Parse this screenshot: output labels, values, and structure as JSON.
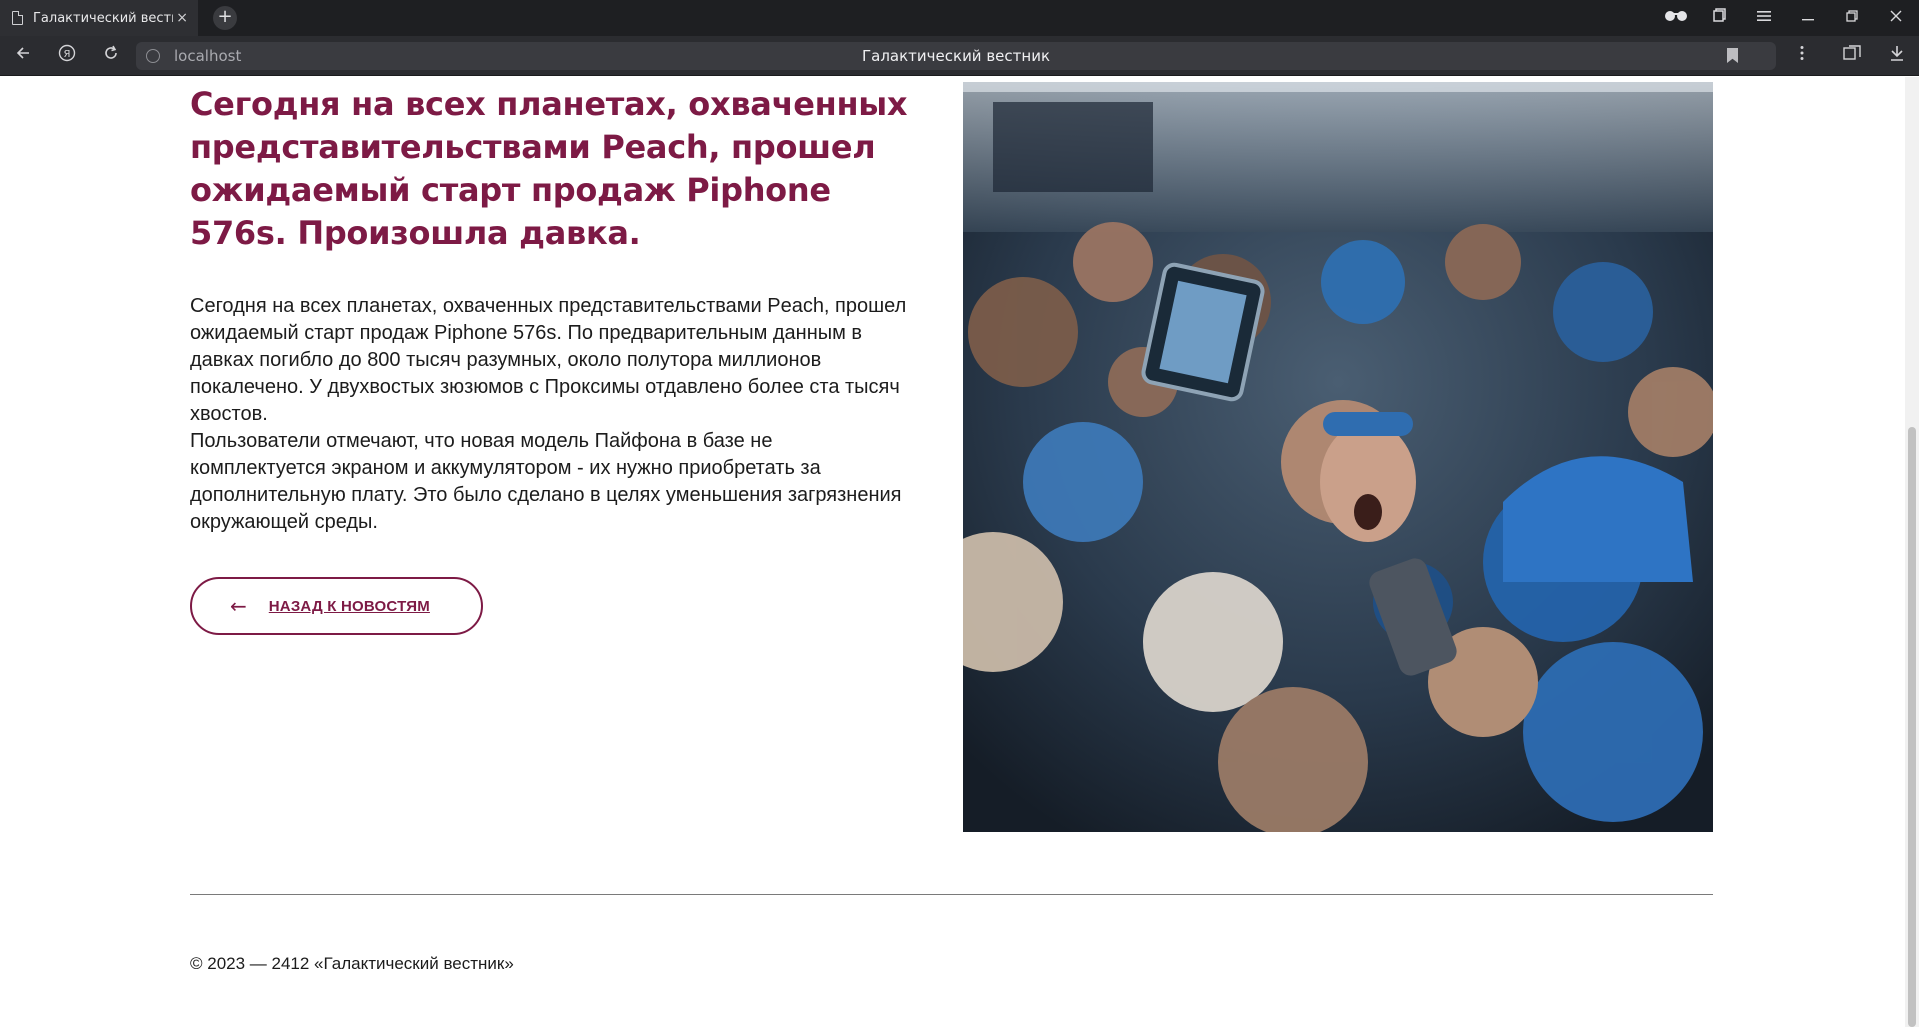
{
  "browser": {
    "tab_title": "Галактический вестник",
    "tab_close": "×",
    "new_tab": "+",
    "url": "localhost",
    "page_title": "Галактический вестник"
  },
  "article": {
    "headline": "Сегодня на всех планетах, охваченных представительствами Peach, прошел ожидаемый старт продаж Piphone 576s. Произошла давка.",
    "paragraph1": "Сегодня на всех планетах, охваченных представительствами Peach, прошел ожидаемый старт продаж Piphone 576s. По предварительным данным в давках погибло до 800 тысяч разумных, около полутора миллионов покалечено. У двухвостых зюзюмов с Проксимы отдавлено более ста тысяч хвостов.",
    "paragraph2": "Пользователи отмечают, что новая модель Пайфона в базе не комплектуется экраном и аккумулятором - их нужно приобретать за дополнительную плату. Это было сделано в целях уменьшения загрязнения окружающей среды.",
    "back_arrow": "←",
    "back_label": "НАЗАД К НОВОСТЯМ"
  },
  "footer": {
    "copyright": "© 2023 — 2412 «Галактический вестник»"
  },
  "colors": {
    "accent": "#7d1a45",
    "chrome_dark": "#1e1f22"
  },
  "icons": [
    "page-icon",
    "close-icon",
    "plus-icon",
    "glasses-icon",
    "collections-icon",
    "menu-icon",
    "minimize-icon",
    "restore-icon",
    "close-window-icon",
    "back-icon",
    "yandex-icon",
    "reload-icon",
    "site-info-icon",
    "bookmark-icon",
    "more-icon",
    "reader-icon",
    "downloads-icon",
    "arrow-left-icon"
  ]
}
